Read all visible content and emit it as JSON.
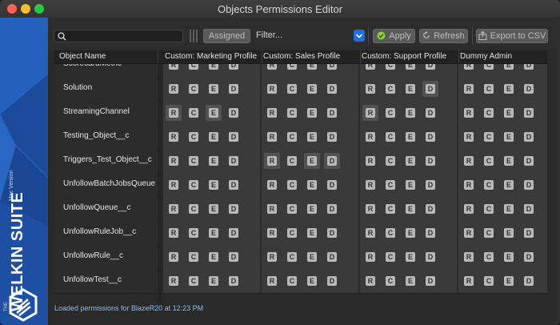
{
  "window": {
    "title": "Objects Permissions Editor"
  },
  "brand": {
    "prefix": "THE",
    "name": "WELKIN SUITE",
    "edition": "Mac Version",
    "logo_icon": "welkin-hexagon-logo"
  },
  "toolbar": {
    "search": {
      "value": "",
      "placeholder": "",
      "icon": "search-icon"
    },
    "assigned_label": "Assigned",
    "filter_label": "Filter...",
    "apply_label": "Apply",
    "refresh_label": "Refresh",
    "export_label": "Export to CSV"
  },
  "grid": {
    "name_header": "Object Name",
    "profiles": [
      "Custom: Marketing Profile",
      "Custom: Sales Profile",
      "Custom: Support Profile",
      "Dummy Admin"
    ],
    "flags": [
      "R",
      "C",
      "E",
      "D"
    ],
    "rows": [
      {
        "name": "ScorecardMetric",
        "active": [
          [],
          [],
          [],
          []
        ]
      },
      {
        "name": "Solution",
        "active": [
          [],
          [],
          [
            "D"
          ],
          []
        ]
      },
      {
        "name": "StreamingChannel",
        "active": [
          [
            "R",
            "E"
          ],
          [],
          [
            "R"
          ],
          []
        ]
      },
      {
        "name": "Testing_Object__c",
        "active": [
          [],
          [],
          [],
          []
        ]
      },
      {
        "name": "Triggers_Test_Object__c",
        "active": [
          [],
          [
            "R",
            "E",
            "D"
          ],
          [],
          []
        ]
      },
      {
        "name": "UnfollowBatchJobsQueue",
        "active": [
          [],
          [],
          [],
          []
        ]
      },
      {
        "name": "UnfollowQueue__c",
        "active": [
          [],
          [],
          [],
          []
        ]
      },
      {
        "name": "UnfollowRuleJob__c",
        "active": [
          [],
          [],
          [],
          []
        ]
      },
      {
        "name": "UnfollowRule__c",
        "active": [
          [],
          [],
          [],
          []
        ]
      },
      {
        "name": "UnfollowTest__c",
        "active": [
          [],
          [],
          [],
          []
        ]
      }
    ]
  },
  "status": "Loaded permissions for BlazeR20 at 12:23 PM",
  "colors": {
    "sidebar": "#1f52a8",
    "status_text": "#87bfff",
    "dropdown_accent": "#1f6fe0",
    "apply_icon": "#8ccf3a"
  }
}
